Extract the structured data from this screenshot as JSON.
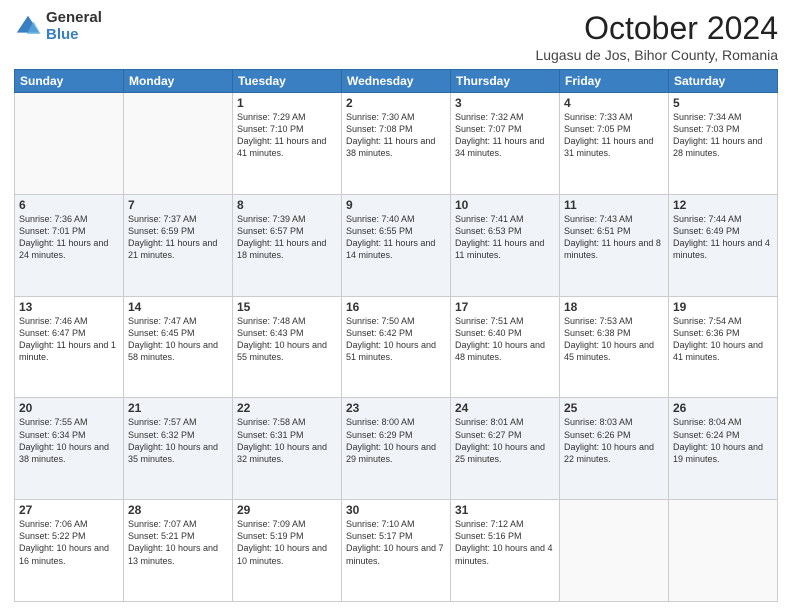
{
  "logo": {
    "general": "General",
    "blue": "Blue"
  },
  "header": {
    "title": "October 2024",
    "subtitle": "Lugasu de Jos, Bihor County, Romania"
  },
  "days": [
    "Sunday",
    "Monday",
    "Tuesday",
    "Wednesday",
    "Thursday",
    "Friday",
    "Saturday"
  ],
  "weeks": [
    [
      {
        "num": "",
        "sunrise": "",
        "sunset": "",
        "daylight": "",
        "empty": true
      },
      {
        "num": "",
        "sunrise": "",
        "sunset": "",
        "daylight": "",
        "empty": true
      },
      {
        "num": "1",
        "sunrise": "Sunrise: 7:29 AM",
        "sunset": "Sunset: 7:10 PM",
        "daylight": "Daylight: 11 hours and 41 minutes.",
        "empty": false
      },
      {
        "num": "2",
        "sunrise": "Sunrise: 7:30 AM",
        "sunset": "Sunset: 7:08 PM",
        "daylight": "Daylight: 11 hours and 38 minutes.",
        "empty": false
      },
      {
        "num": "3",
        "sunrise": "Sunrise: 7:32 AM",
        "sunset": "Sunset: 7:07 PM",
        "daylight": "Daylight: 11 hours and 34 minutes.",
        "empty": false
      },
      {
        "num": "4",
        "sunrise": "Sunrise: 7:33 AM",
        "sunset": "Sunset: 7:05 PM",
        "daylight": "Daylight: 11 hours and 31 minutes.",
        "empty": false
      },
      {
        "num": "5",
        "sunrise": "Sunrise: 7:34 AM",
        "sunset": "Sunset: 7:03 PM",
        "daylight": "Daylight: 11 hours and 28 minutes.",
        "empty": false
      }
    ],
    [
      {
        "num": "6",
        "sunrise": "Sunrise: 7:36 AM",
        "sunset": "Sunset: 7:01 PM",
        "daylight": "Daylight: 11 hours and 24 minutes.",
        "empty": false
      },
      {
        "num": "7",
        "sunrise": "Sunrise: 7:37 AM",
        "sunset": "Sunset: 6:59 PM",
        "daylight": "Daylight: 11 hours and 21 minutes.",
        "empty": false
      },
      {
        "num": "8",
        "sunrise": "Sunrise: 7:39 AM",
        "sunset": "Sunset: 6:57 PM",
        "daylight": "Daylight: 11 hours and 18 minutes.",
        "empty": false
      },
      {
        "num": "9",
        "sunrise": "Sunrise: 7:40 AM",
        "sunset": "Sunset: 6:55 PM",
        "daylight": "Daylight: 11 hours and 14 minutes.",
        "empty": false
      },
      {
        "num": "10",
        "sunrise": "Sunrise: 7:41 AM",
        "sunset": "Sunset: 6:53 PM",
        "daylight": "Daylight: 11 hours and 11 minutes.",
        "empty": false
      },
      {
        "num": "11",
        "sunrise": "Sunrise: 7:43 AM",
        "sunset": "Sunset: 6:51 PM",
        "daylight": "Daylight: 11 hours and 8 minutes.",
        "empty": false
      },
      {
        "num": "12",
        "sunrise": "Sunrise: 7:44 AM",
        "sunset": "Sunset: 6:49 PM",
        "daylight": "Daylight: 11 hours and 4 minutes.",
        "empty": false
      }
    ],
    [
      {
        "num": "13",
        "sunrise": "Sunrise: 7:46 AM",
        "sunset": "Sunset: 6:47 PM",
        "daylight": "Daylight: 11 hours and 1 minute.",
        "empty": false
      },
      {
        "num": "14",
        "sunrise": "Sunrise: 7:47 AM",
        "sunset": "Sunset: 6:45 PM",
        "daylight": "Daylight: 10 hours and 58 minutes.",
        "empty": false
      },
      {
        "num": "15",
        "sunrise": "Sunrise: 7:48 AM",
        "sunset": "Sunset: 6:43 PM",
        "daylight": "Daylight: 10 hours and 55 minutes.",
        "empty": false
      },
      {
        "num": "16",
        "sunrise": "Sunrise: 7:50 AM",
        "sunset": "Sunset: 6:42 PM",
        "daylight": "Daylight: 10 hours and 51 minutes.",
        "empty": false
      },
      {
        "num": "17",
        "sunrise": "Sunrise: 7:51 AM",
        "sunset": "Sunset: 6:40 PM",
        "daylight": "Daylight: 10 hours and 48 minutes.",
        "empty": false
      },
      {
        "num": "18",
        "sunrise": "Sunrise: 7:53 AM",
        "sunset": "Sunset: 6:38 PM",
        "daylight": "Daylight: 10 hours and 45 minutes.",
        "empty": false
      },
      {
        "num": "19",
        "sunrise": "Sunrise: 7:54 AM",
        "sunset": "Sunset: 6:36 PM",
        "daylight": "Daylight: 10 hours and 41 minutes.",
        "empty": false
      }
    ],
    [
      {
        "num": "20",
        "sunrise": "Sunrise: 7:55 AM",
        "sunset": "Sunset: 6:34 PM",
        "daylight": "Daylight: 10 hours and 38 minutes.",
        "empty": false
      },
      {
        "num": "21",
        "sunrise": "Sunrise: 7:57 AM",
        "sunset": "Sunset: 6:32 PM",
        "daylight": "Daylight: 10 hours and 35 minutes.",
        "empty": false
      },
      {
        "num": "22",
        "sunrise": "Sunrise: 7:58 AM",
        "sunset": "Sunset: 6:31 PM",
        "daylight": "Daylight: 10 hours and 32 minutes.",
        "empty": false
      },
      {
        "num": "23",
        "sunrise": "Sunrise: 8:00 AM",
        "sunset": "Sunset: 6:29 PM",
        "daylight": "Daylight: 10 hours and 29 minutes.",
        "empty": false
      },
      {
        "num": "24",
        "sunrise": "Sunrise: 8:01 AM",
        "sunset": "Sunset: 6:27 PM",
        "daylight": "Daylight: 10 hours and 25 minutes.",
        "empty": false
      },
      {
        "num": "25",
        "sunrise": "Sunrise: 8:03 AM",
        "sunset": "Sunset: 6:26 PM",
        "daylight": "Daylight: 10 hours and 22 minutes.",
        "empty": false
      },
      {
        "num": "26",
        "sunrise": "Sunrise: 8:04 AM",
        "sunset": "Sunset: 6:24 PM",
        "daylight": "Daylight: 10 hours and 19 minutes.",
        "empty": false
      }
    ],
    [
      {
        "num": "27",
        "sunrise": "Sunrise: 7:06 AM",
        "sunset": "Sunset: 5:22 PM",
        "daylight": "Daylight: 10 hours and 16 minutes.",
        "empty": false
      },
      {
        "num": "28",
        "sunrise": "Sunrise: 7:07 AM",
        "sunset": "Sunset: 5:21 PM",
        "daylight": "Daylight: 10 hours and 13 minutes.",
        "empty": false
      },
      {
        "num": "29",
        "sunrise": "Sunrise: 7:09 AM",
        "sunset": "Sunset: 5:19 PM",
        "daylight": "Daylight: 10 hours and 10 minutes.",
        "empty": false
      },
      {
        "num": "30",
        "sunrise": "Sunrise: 7:10 AM",
        "sunset": "Sunset: 5:17 PM",
        "daylight": "Daylight: 10 hours and 7 minutes.",
        "empty": false
      },
      {
        "num": "31",
        "sunrise": "Sunrise: 7:12 AM",
        "sunset": "Sunset: 5:16 PM",
        "daylight": "Daylight: 10 hours and 4 minutes.",
        "empty": false
      },
      {
        "num": "",
        "sunrise": "",
        "sunset": "",
        "daylight": "",
        "empty": true
      },
      {
        "num": "",
        "sunrise": "",
        "sunset": "",
        "daylight": "",
        "empty": true
      }
    ]
  ]
}
